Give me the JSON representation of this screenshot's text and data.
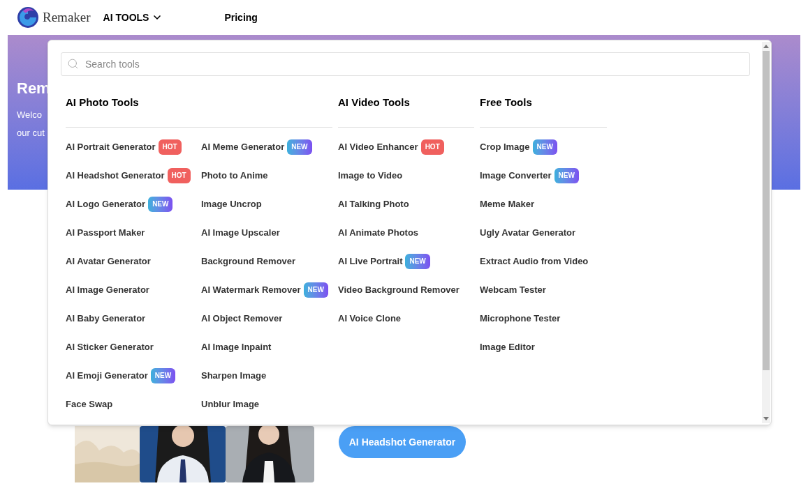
{
  "header": {
    "logo": "Remaker",
    "nav": [
      {
        "label": "AI TOOLS",
        "kind": "dropdown"
      },
      {
        "label": "Pricing",
        "kind": "link"
      }
    ]
  },
  "hero": {
    "title": "Rem",
    "lines": [
      "Welco",
      "our cut"
    ]
  },
  "menu": {
    "search": {
      "placeholder": "Search tools"
    },
    "sections": [
      {
        "title": "AI Photo Tools",
        "columns": [
          [
            {
              "label": "AI Portrait Generator",
              "badge": {
                "text": "HOT",
                "kind": "hot"
              }
            },
            {
              "label": "AI Headshot Generator",
              "badge": {
                "text": "HOT",
                "kind": "hot"
              }
            },
            {
              "label": "AI Logo Generator",
              "badge": {
                "text": "NEW",
                "kind": "new"
              }
            },
            {
              "label": "AI Passport Maker"
            },
            {
              "label": "AI Avatar Generator"
            },
            {
              "label": "AI Image Generator"
            },
            {
              "label": "AI Baby Generator"
            },
            {
              "label": "AI Sticker Generator"
            },
            {
              "label": "AI Emoji Generator",
              "badge": {
                "text": "NEW",
                "kind": "new"
              }
            },
            {
              "label": "Face Swap"
            }
          ],
          [
            {
              "label": "AI Meme Generator",
              "badge": {
                "text": "NEW",
                "kind": "new"
              }
            },
            {
              "label": "Photo to Anime"
            },
            {
              "label": "Image Uncrop"
            },
            {
              "label": "AI Image Upscaler"
            },
            {
              "label": "Background Remover"
            },
            {
              "label": "AI Watermark Remover",
              "badge": {
                "text": "NEW",
                "kind": "new"
              }
            },
            {
              "label": "AI Object Remover"
            },
            {
              "label": "AI Image Inpaint"
            },
            {
              "label": "Sharpen Image"
            },
            {
              "label": "Unblur Image"
            }
          ]
        ]
      },
      {
        "title": "AI Video Tools",
        "columns": [
          [
            {
              "label": "AI Video Enhancer",
              "badge": {
                "text": "HOT",
                "kind": "hot"
              }
            },
            {
              "label": "Image to Video"
            },
            {
              "label": "AI Talking Photo"
            },
            {
              "label": "AI Animate Photos"
            },
            {
              "label": "AI Live Portrait",
              "badge": {
                "text": "NEW",
                "kind": "new"
              }
            },
            {
              "label": "Video Background Remover"
            },
            {
              "label": "AI Voice Clone"
            }
          ]
        ]
      },
      {
        "title": "Free Tools",
        "columns": [
          [
            {
              "label": "Crop Image",
              "badge": {
                "text": "NEW",
                "kind": "new"
              }
            },
            {
              "label": "Image Converter",
              "badge": {
                "text": "NEW",
                "kind": "new"
              }
            },
            {
              "label": "Meme Maker"
            },
            {
              "label": "Ugly Avatar Generator"
            },
            {
              "label": "Extract Audio from Video"
            },
            {
              "label": "Webcam Tester"
            },
            {
              "label": "Microphone Tester"
            },
            {
              "label": "Image Editor"
            }
          ]
        ]
      }
    ]
  },
  "cta": {
    "button": "AI Headshot Generator"
  }
}
